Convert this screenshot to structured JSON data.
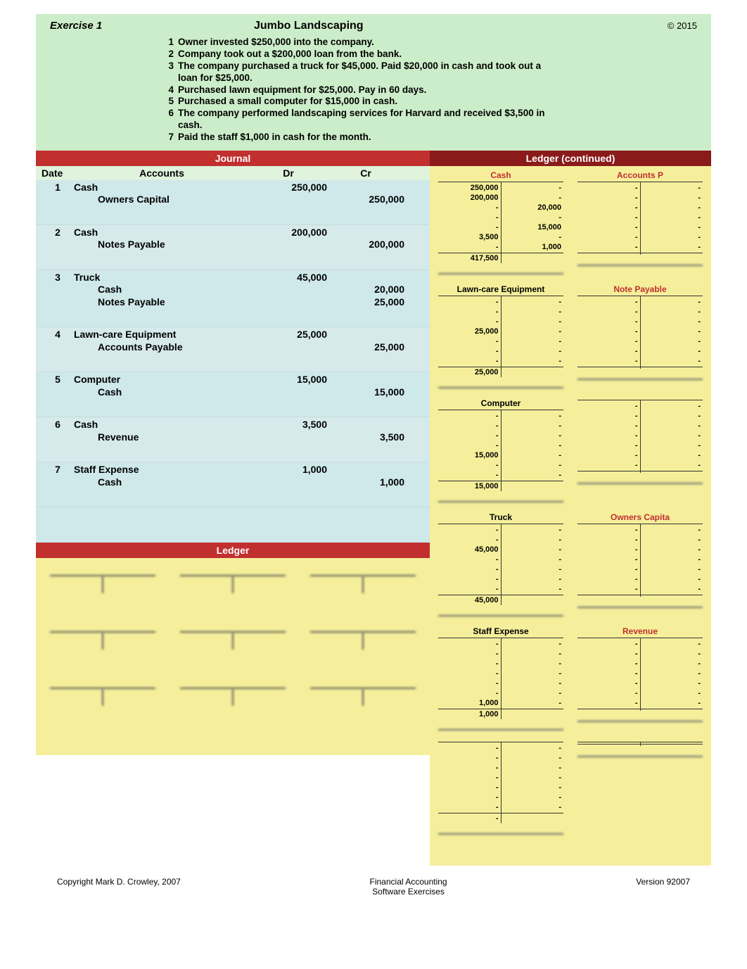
{
  "header": {
    "exercise_label": "Exercise 1",
    "company": "Jumbo Landscaping",
    "copyright_year": "© 2015"
  },
  "transactions": [
    {
      "n": "1",
      "text": "Owner invested $250,000 into the company."
    },
    {
      "n": "2",
      "text": "Company took out a $200,000 loan from the bank."
    },
    {
      "n": "3",
      "text": "The company purchased a truck for $45,000.  Paid $20,000 in cash and took out a loan for $25,000."
    },
    {
      "n": "4",
      "text": "Purchased lawn equipment for $25,000. Pay in 60 days."
    },
    {
      "n": "5",
      "text": "Purchased a small computer for $15,000 in cash."
    },
    {
      "n": "6",
      "text": "The company performed landscaping services for Harvard and received $3,500 in cash."
    },
    {
      "n": "7",
      "text": "Paid the staff $1,000 in cash for the month."
    }
  ],
  "journal": {
    "title": "Journal",
    "head": {
      "date": "Date",
      "accounts": "Accounts",
      "dr": "Dr",
      "cr": "Cr"
    },
    "entries": [
      {
        "date": "1",
        "lines": [
          {
            "acct": "Cash",
            "dr": "250,000",
            "cr": ""
          },
          {
            "acct": "Owners Capital",
            "indent": true,
            "dr": "",
            "cr": "250,000"
          }
        ]
      },
      {
        "date": "2",
        "lines": [
          {
            "acct": "Cash",
            "dr": "200,000",
            "cr": ""
          },
          {
            "acct": "Notes Payable",
            "indent": true,
            "dr": "",
            "cr": "200,000"
          }
        ]
      },
      {
        "date": "3",
        "lines": [
          {
            "acct": "Truck",
            "dr": "45,000",
            "cr": ""
          },
          {
            "acct": "Cash",
            "indent": true,
            "dr": "",
            "cr": "20,000"
          },
          {
            "acct": "Notes Payable",
            "indent": true,
            "dr": "",
            "cr": "25,000"
          }
        ]
      },
      {
        "date": "4",
        "lines": [
          {
            "acct": "Lawn-care Equipment",
            "dr": "25,000",
            "cr": ""
          },
          {
            "acct": "Accounts Payable",
            "indent": true,
            "dr": "",
            "cr": "25,000"
          }
        ]
      },
      {
        "date": "5",
        "lines": [
          {
            "acct": "Computer",
            "dr": "15,000",
            "cr": ""
          },
          {
            "acct": "Cash",
            "indent": true,
            "dr": "",
            "cr": "15,000"
          }
        ]
      },
      {
        "date": "6",
        "lines": [
          {
            "acct": "Cash",
            "dr": "3,500",
            "cr": ""
          },
          {
            "acct": "Revenue",
            "indent": true,
            "dr": "",
            "cr": "3,500"
          }
        ]
      },
      {
        "date": "7",
        "lines": [
          {
            "acct": "Staff Expense",
            "dr": "1,000",
            "cr": ""
          },
          {
            "acct": "Cash",
            "indent": true,
            "dr": "",
            "cr": "1,000"
          }
        ]
      }
    ],
    "ledger_title": "Ledger"
  },
  "ledger_continued": {
    "title": "Ledger (continued)",
    "accounts": [
      {
        "name": "Cash",
        "color": "red",
        "debits": [
          "250,000",
          "200,000",
          "-",
          "-",
          "-",
          "3,500",
          "-"
        ],
        "credits": [
          "-",
          "-",
          "20,000",
          "-",
          "15,000",
          "-",
          "1,000"
        ],
        "total_debit": "417,500",
        "total_credit": ""
      },
      {
        "name": "Accounts P",
        "color": "red",
        "debits": [
          "-",
          "-",
          "-",
          "-",
          "-",
          "-",
          "-"
        ],
        "credits": [
          "-",
          "-",
          "-",
          "-",
          "-",
          "-",
          "-"
        ],
        "total_debit": "",
        "total_credit": ""
      },
      {
        "name": "Lawn-care Equipment",
        "color": "black",
        "debits": [
          "-",
          "-",
          "-",
          "25,000",
          "-",
          "-",
          "-"
        ],
        "credits": [
          "-",
          "-",
          "-",
          "-",
          "-",
          "-",
          "-"
        ],
        "total_debit": "25,000",
        "total_credit": ""
      },
      {
        "name": "Note Payable",
        "color": "red",
        "debits": [
          "-",
          "-",
          "-",
          "-",
          "-",
          "-",
          "-"
        ],
        "credits": [
          "-",
          "-",
          "-",
          "-",
          "-",
          "-",
          "-"
        ],
        "total_debit": "",
        "total_credit": ""
      },
      {
        "name": "Computer",
        "color": "black",
        "debits": [
          "-",
          "-",
          "-",
          "-",
          "15,000",
          "-",
          "-"
        ],
        "credits": [
          "-",
          "-",
          "-",
          "-",
          "-",
          "-",
          "-"
        ],
        "total_debit": "15,000",
        "total_credit": ""
      },
      {
        "name": "",
        "color": "black",
        "debits": [
          "-",
          "-",
          "-",
          "-",
          "-",
          "-",
          "-"
        ],
        "credits": [
          "-",
          "-",
          "-",
          "-",
          "-",
          "-",
          "-"
        ],
        "total_debit": "",
        "total_credit": ""
      },
      {
        "name": "Truck",
        "color": "black",
        "debits": [
          "-",
          "-",
          "45,000",
          "-",
          "-",
          "-",
          "-"
        ],
        "credits": [
          "-",
          "-",
          "-",
          "-",
          "-",
          "-",
          "-"
        ],
        "total_debit": "45,000",
        "total_credit": ""
      },
      {
        "name": "Owners Capita",
        "color": "red",
        "debits": [
          "-",
          "-",
          "-",
          "-",
          "-",
          "-",
          "-"
        ],
        "credits": [
          "-",
          "-",
          "-",
          "-",
          "-",
          "-",
          "-"
        ],
        "total_debit": "",
        "total_credit": ""
      },
      {
        "name": "Staff Expense",
        "color": "black",
        "debits": [
          "-",
          "-",
          "-",
          "-",
          "-",
          "-",
          "1,000"
        ],
        "credits": [
          "-",
          "-",
          "-",
          "-",
          "-",
          "-",
          "-"
        ],
        "total_debit": "1,000",
        "total_credit": ""
      },
      {
        "name": "Revenue",
        "color": "red",
        "debits": [
          "-",
          "-",
          "-",
          "-",
          "-",
          "-",
          "-"
        ],
        "credits": [
          "-",
          "-",
          "-",
          "-",
          "-",
          "-",
          "-"
        ],
        "total_debit": "",
        "total_credit": ""
      },
      {
        "name": "",
        "color": "black",
        "debits": [
          "-",
          "-",
          "-",
          "-",
          "-",
          "-",
          "-"
        ],
        "credits": [
          "-",
          "-",
          "-",
          "-",
          "-",
          "-",
          "-"
        ],
        "total_debit": "-",
        "total_credit": ""
      },
      {
        "name": "",
        "color": "black",
        "debits": [],
        "credits": [],
        "total_debit": "",
        "total_credit": ""
      }
    ]
  },
  "footer": {
    "left": "Copyright Mark D. Crowley, 2007",
    "center1": "Financial Accounting",
    "center2": "Software Exercises",
    "right": "Version 92007"
  }
}
